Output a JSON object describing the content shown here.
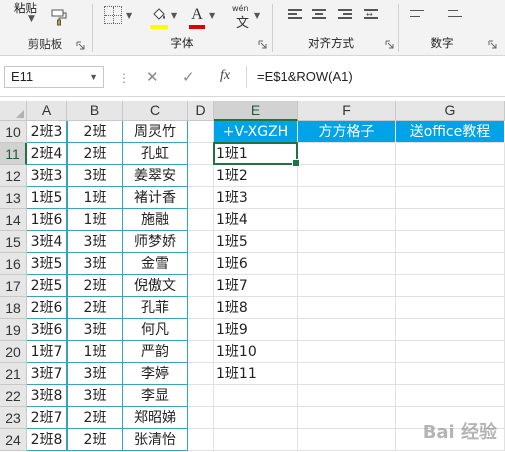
{
  "ribbon": {
    "paste_label": "粘贴",
    "clipboard_group": "剪贴板",
    "font_group": "字体",
    "alignment_group": "对齐方式",
    "number_group": "数字",
    "wen_top": "wén",
    "wen_char": "文",
    "font_color_letter": "A",
    "fill_color": "#ffff00",
    "font_color": "#e00000"
  },
  "formula_bar": {
    "name_box": "E11",
    "cancel_icon": "✕",
    "enter_icon": "✓",
    "fx_label": "fx",
    "formula": "=E$1&ROW(A1)"
  },
  "columns": [
    "A",
    "B",
    "C",
    "D",
    "E",
    "F",
    "G"
  ],
  "selected_column": "E",
  "selected_row": "11",
  "rows": [
    {
      "num": "10",
      "a": "2班3",
      "b": "2班",
      "c": "周灵竹",
      "e": "+V-XGZH",
      "f": "方方格子",
      "g": "送office教程"
    },
    {
      "num": "11",
      "a": "2班4",
      "b": "2班",
      "c": "孔虹",
      "e": "1班1",
      "f": "",
      "g": ""
    },
    {
      "num": "12",
      "a": "3班3",
      "b": "3班",
      "c": "姜翠安",
      "e": "1班2",
      "f": "",
      "g": ""
    },
    {
      "num": "13",
      "a": "1班5",
      "b": "1班",
      "c": "褚计香",
      "e": "1班3",
      "f": "",
      "g": ""
    },
    {
      "num": "14",
      "a": "1班6",
      "b": "1班",
      "c": "施融",
      "e": "1班4",
      "f": "",
      "g": ""
    },
    {
      "num": "15",
      "a": "3班4",
      "b": "3班",
      "c": "师梦娇",
      "e": "1班5",
      "f": "",
      "g": ""
    },
    {
      "num": "16",
      "a": "3班5",
      "b": "3班",
      "c": "金雪",
      "e": "1班6",
      "f": "",
      "g": ""
    },
    {
      "num": "17",
      "a": "2班5",
      "b": "2班",
      "c": "倪傲文",
      "e": "1班7",
      "f": "",
      "g": ""
    },
    {
      "num": "18",
      "a": "2班6",
      "b": "2班",
      "c": "孔菲",
      "e": "1班8",
      "f": "",
      "g": ""
    },
    {
      "num": "19",
      "a": "3班6",
      "b": "3班",
      "c": "何凡",
      "e": "1班9",
      "f": "",
      "g": ""
    },
    {
      "num": "20",
      "a": "1班7",
      "b": "1班",
      "c": "严韵",
      "e": "1班10",
      "f": "",
      "g": ""
    },
    {
      "num": "21",
      "a": "3班7",
      "b": "3班",
      "c": "李婷",
      "e": "1班11",
      "f": "",
      "g": ""
    },
    {
      "num": "22",
      "a": "3班8",
      "b": "3班",
      "c": "李显",
      "e": "",
      "f": "",
      "g": ""
    },
    {
      "num": "23",
      "a": "2班7",
      "b": "2班",
      "c": "郑昭娣",
      "e": "",
      "f": "",
      "g": ""
    },
    {
      "num": "24",
      "a": "2班8",
      "b": "2班",
      "c": "张清怡",
      "e": "",
      "f": "",
      "g": ""
    }
  ],
  "header_fill_color": "#00a2e8",
  "watermark": "Bai 经验"
}
